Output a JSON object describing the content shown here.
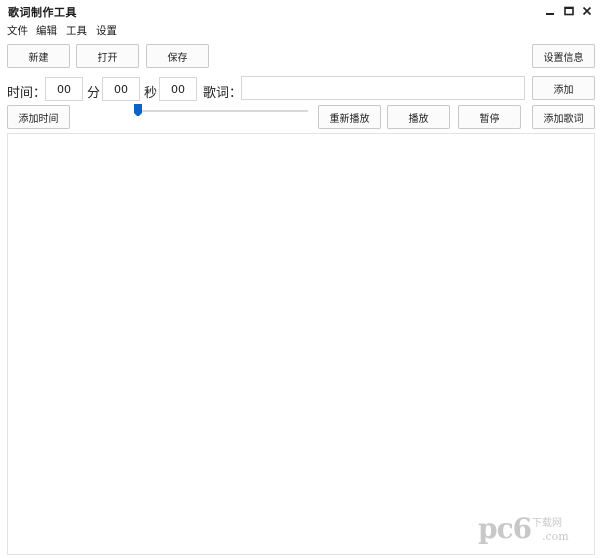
{
  "window": {
    "title": "歌词制作工具",
    "minimize_icon": "minimize-icon",
    "maximize_icon": "maximize-icon",
    "close_icon": "close-icon"
  },
  "menu": {
    "file": "文件",
    "edit": "编辑",
    "tools": "工具",
    "settings": "设置"
  },
  "toolbar": {
    "new": "新建",
    "open": "打开",
    "save": "保存",
    "settings_info": "设置信息"
  },
  "time": {
    "time_label": "时间：",
    "minute_value": "00",
    "minute_label": "分",
    "second_value": "00",
    "second_label": "秒",
    "ms_value": "00",
    "lyric_label": "歌词：",
    "lyric_value": ""
  },
  "actions": {
    "add": "添加",
    "add_time": "添加时间",
    "replay": "重新播放",
    "play": "播放",
    "pause": "暂停",
    "add_lyric": "添加歌词"
  },
  "slider": {
    "position": 0
  },
  "watermark": {
    "brand": "pc6",
    "domain": ".com",
    "cn": "下载网"
  },
  "colors": {
    "accent": "#0a64c8"
  }
}
